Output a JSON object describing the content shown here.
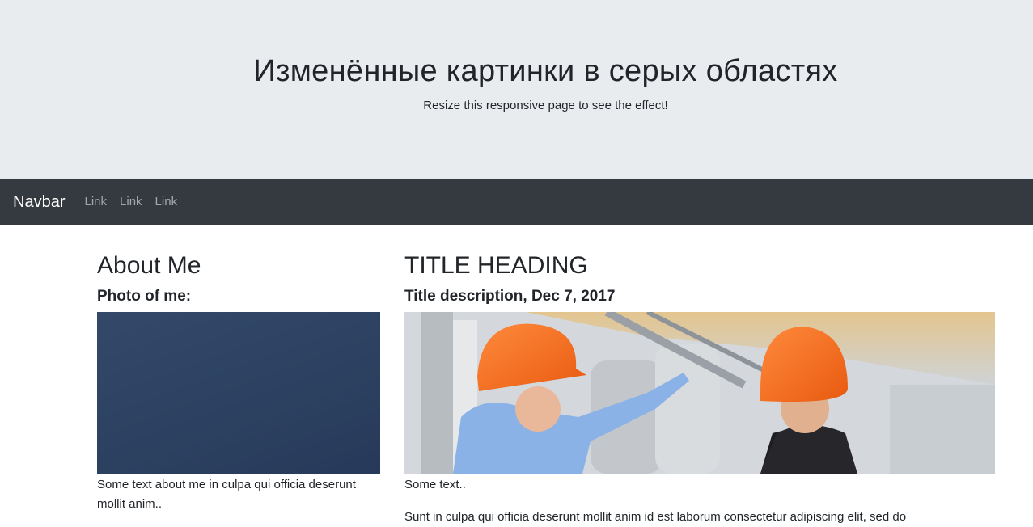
{
  "header": {
    "title": "Изменённые картинки в серых областях",
    "subtitle": "Resize this responsive page to see the effect!"
  },
  "navbar": {
    "brand": "Navbar",
    "links": [
      "Link",
      "Link",
      "Link"
    ]
  },
  "sidebar": {
    "heading": "About Me",
    "photo_label": "Photo of me:",
    "text": "Some text about me in culpa qui officia deserunt mollit anim.."
  },
  "main": {
    "heading": "TITLE HEADING",
    "description": "Title description, Dec 7, 2017",
    "text1": "Some text..",
    "text2": "Sunt in culpa qui officia deserunt mollit anim id est laborum consectetur adipiscing elit, sed do"
  },
  "colors": {
    "jumbotron_bg": "#e9ecef",
    "navbar_bg": "#343a40",
    "photo_placeholder": "#2f4465"
  }
}
